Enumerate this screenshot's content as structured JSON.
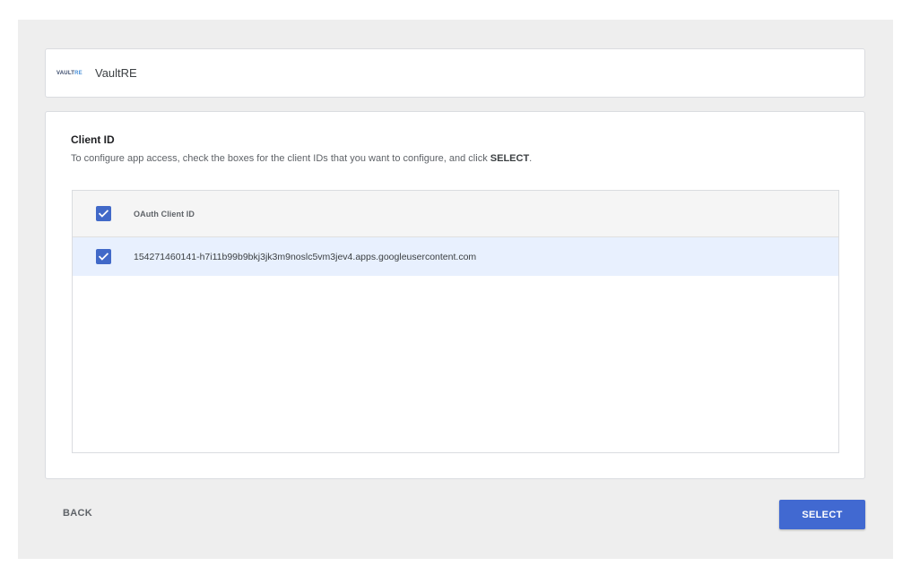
{
  "app": {
    "logo_text_vault": "VAULT",
    "logo_text_re": "RE",
    "name": "VaultRE"
  },
  "section": {
    "title": "Client ID",
    "description_prefix": "To configure app access, check the boxes for the client IDs that you want to configure, and click ",
    "description_bold": "SELECT",
    "description_suffix": "."
  },
  "table": {
    "header_checked": true,
    "column_header": "OAuth Client ID",
    "rows": [
      {
        "checked": true,
        "client_id": "154271460141-h7i11b99b9bkj3jk3m9noslc5vm3jev4.apps.googleusercontent.com"
      }
    ]
  },
  "footer": {
    "back_label": "BACK",
    "select_label": "SELECT"
  },
  "colors": {
    "accent": "#4169d1",
    "selected_row": "#e8f0fe",
    "background": "#eeeeee"
  },
  "icons": {
    "checkbox": "checkbox-checked-icon"
  }
}
